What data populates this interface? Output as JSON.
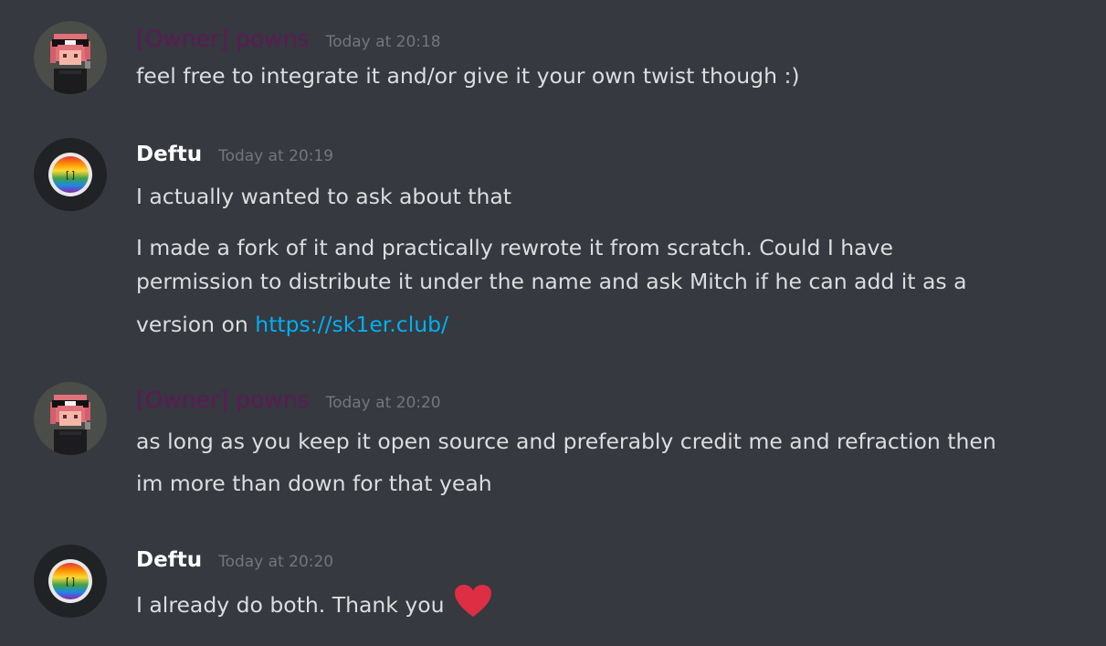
{
  "messages": [
    {
      "author": "[Owner] powns",
      "timestamp": "Today at 20:18",
      "lines": [
        "feel free to integrate it and/or give it your own twist though :)"
      ]
    },
    {
      "author": "Deftu",
      "timestamp": "Today at 20:19",
      "lines": [
        "I actually wanted to ask about that",
        "I made a fork of it and practically rewrote it from scratch. Could I have",
        "permission to distribute it under the name and ask Mitch if he can add it as a",
        "version on "
      ],
      "link": "https://sk1er.club/"
    },
    {
      "author": "[Owner] powns",
      "timestamp": "Today at 20:20",
      "lines": [
        "as long as you keep it open source and preferably credit me and refraction then",
        "im more than down for that yeah"
      ]
    },
    {
      "author": "Deftu",
      "timestamp": "Today at 20:20",
      "lines": [
        "I already do both. Thank you "
      ],
      "emoji": "heart-icon"
    }
  ],
  "colors": {
    "background": "#36393f",
    "owner_role": "#5d1a57",
    "text": "#dcddde",
    "timestamp": "#72767d",
    "link": "#00aff4",
    "heart": "#dd2e44"
  }
}
